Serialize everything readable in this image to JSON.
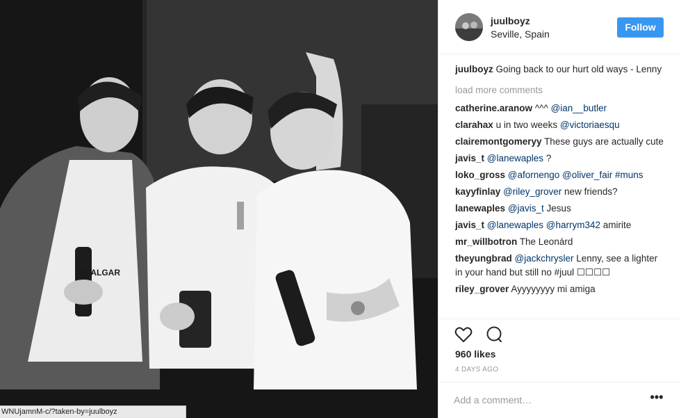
{
  "browser": {
    "status_url": "WNUjamnM-c/?taken-by=juulboyz"
  },
  "post": {
    "username": "juulboyz",
    "location": "Seville, Spain",
    "follow_label": "Follow",
    "caption_user": "juulboyz",
    "caption_text": "Going back to our hurt old ways - Lenny",
    "load_more": "load more comments",
    "likes": "960 likes",
    "time": "4 DAYS AGO",
    "add_comment_placeholder": "Add a comment…",
    "more_label": "•••"
  },
  "comments": [
    {
      "user": "catherine.aranow",
      "pre": "^^^ ",
      "mentions": "@ian__butler",
      "post": ""
    },
    {
      "user": "clarahax",
      "pre": "u in two weeks ",
      "mentions": "@victoriaesqu",
      "post": ""
    },
    {
      "user": "clairemontgomeryy",
      "pre": "These guys are actually cute",
      "mentions": "",
      "post": ""
    },
    {
      "user": "javis_t",
      "pre": "",
      "mentions": "@lanewaples",
      "post": " ?"
    },
    {
      "user": "loko_gross",
      "pre": "",
      "mentions": "@afornengo @oliver_fair #muns",
      "post": ""
    },
    {
      "user": "kayyfinlay",
      "pre": "",
      "mentions": "@riley_grover",
      "post": " new friends?"
    },
    {
      "user": "lanewaples",
      "pre": "",
      "mentions": "@javis_t",
      "post": " Jesus"
    },
    {
      "user": "javis_t",
      "pre": "",
      "mentions": "@lanewaples @harrym342",
      "post": " amirite"
    },
    {
      "user": "mr_willbotron",
      "pre": "The Leonárd",
      "mentions": "",
      "post": ""
    },
    {
      "user": "theyungbrad",
      "pre": "",
      "mentions": "@jackchrysler",
      "post": " Lenny, see a lighter in your hand but still no #juul ☐☐☐☐"
    },
    {
      "user": "riley_grover",
      "pre": "Ayyyyyyyy mi amiga",
      "mentions": "",
      "post": ""
    }
  ],
  "icons": {
    "like": "heart-outline-icon",
    "comment": "speech-bubble-icon",
    "more": "ellipsis-icon"
  },
  "colors": {
    "follow_button": "#3897f0",
    "mention": "#003569",
    "muted": "#999999"
  }
}
